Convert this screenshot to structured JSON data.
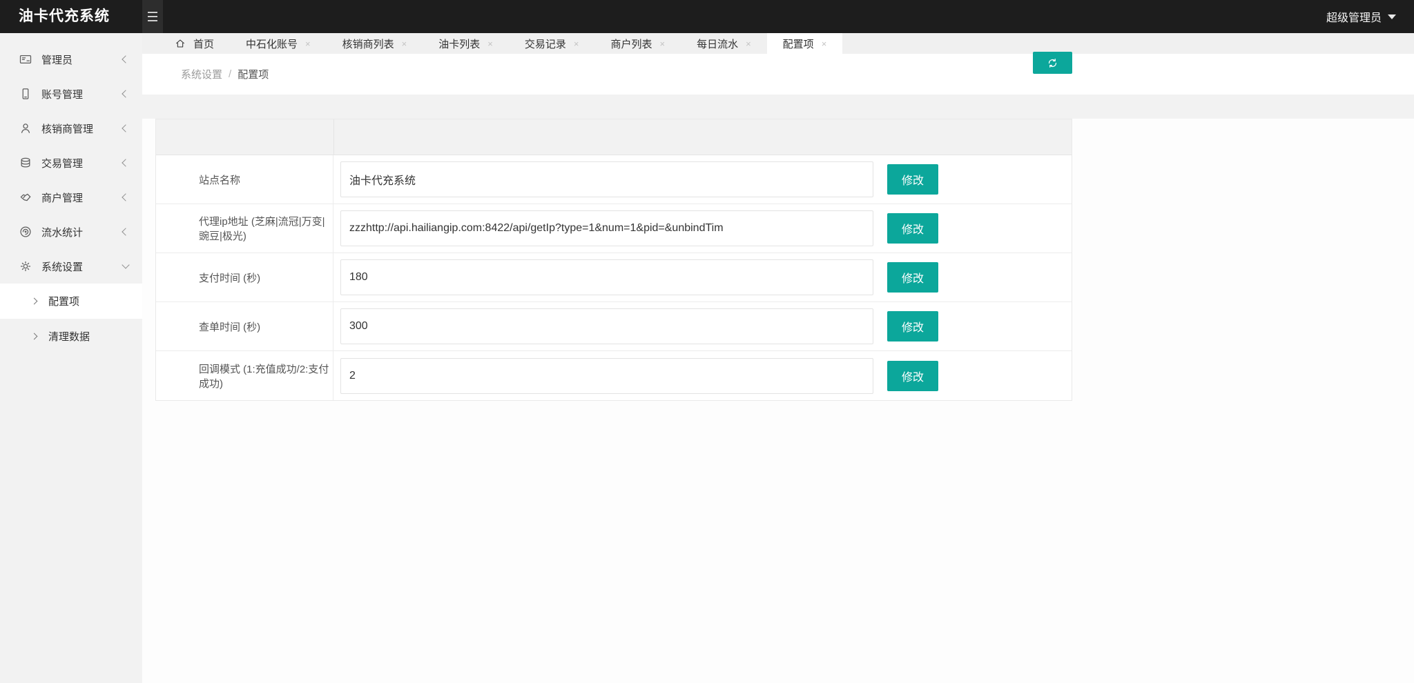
{
  "header": {
    "title": "油卡代充系统",
    "user_menu": "超级管理员"
  },
  "icons": {
    "close": "×"
  },
  "sidebar": {
    "items": [
      {
        "label": "管理员",
        "icon": "id-badge"
      },
      {
        "label": "账号管理",
        "icon": "mobile"
      },
      {
        "label": "核销商管理",
        "icon": "user"
      },
      {
        "label": "交易管理",
        "icon": "database"
      },
      {
        "label": "商户管理",
        "icon": "handshake"
      },
      {
        "label": "流水统计",
        "icon": "spiral"
      },
      {
        "label": "系统设置",
        "icon": "gear",
        "expanded": true
      }
    ],
    "subitems": [
      {
        "label": "配置项",
        "active": true
      },
      {
        "label": "清理数据",
        "active": false
      }
    ]
  },
  "tabs": [
    {
      "label": "首页",
      "closable": false,
      "active": false
    },
    {
      "label": "中石化账号",
      "closable": true,
      "active": false
    },
    {
      "label": "核销商列表",
      "closable": true,
      "active": false
    },
    {
      "label": "油卡列表",
      "closable": true,
      "active": false
    },
    {
      "label": "交易记录",
      "closable": true,
      "active": false
    },
    {
      "label": "商户列表",
      "closable": true,
      "active": false
    },
    {
      "label": "每日流水",
      "closable": true,
      "active": false
    },
    {
      "label": "配置项",
      "closable": true,
      "active": true
    }
  ],
  "breadcrumb": {
    "section": "系统设置",
    "separator": "/",
    "current": "配置项"
  },
  "form": {
    "action_label": "修改",
    "rows": [
      {
        "label": "站点名称",
        "value": "油卡代充系统"
      },
      {
        "label": "代理ip地址 (芝麻|流冠|万变|豌豆|极光)",
        "value": "zzzhttp://api.hailiangip.com:8422/api/getIp?type=1&num=1&pid=&unbindTim"
      },
      {
        "label": "支付时间 (秒)",
        "value": "180"
      },
      {
        "label": "查单时间 (秒)",
        "value": "300"
      },
      {
        "label": "回调模式 (1:充值成功/2:支付成功)",
        "value": "2"
      }
    ]
  },
  "colors": {
    "accent": "#0ca79b",
    "header_bg": "#1d1d1d",
    "sidebar_bg": "#f2f2f2"
  }
}
